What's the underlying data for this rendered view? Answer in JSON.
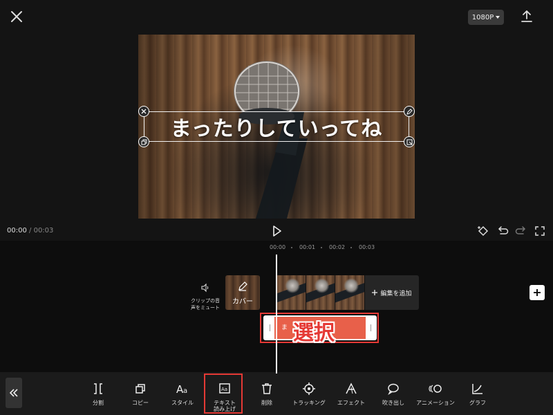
{
  "header": {
    "resolution": "1080P",
    "close_icon": "close-icon",
    "export_icon": "upload-icon"
  },
  "preview": {
    "caption": "まったりしていってね"
  },
  "playback": {
    "current_time": "00:00",
    "separator": "/",
    "duration": "00:03"
  },
  "timeline": {
    "ruler": [
      "00:00",
      "00:01",
      "00:02",
      "00:03"
    ],
    "mute_label": "クリップの音\n声をミュート",
    "cover_label": "カバー",
    "add_edit_label": "編集を追加",
    "text_clip_label": "ま　　　　てね",
    "annotation": "選択"
  },
  "toolbar": {
    "items": [
      {
        "label": "分割",
        "icon": "split-icon"
      },
      {
        "label": "コピー",
        "icon": "copy-icon"
      },
      {
        "label": "スタイル",
        "icon": "style-icon"
      },
      {
        "label": "テキスト\n読み上げ",
        "icon": "text-to-speech-icon"
      },
      {
        "label": "削除",
        "icon": "delete-icon"
      },
      {
        "label": "トラッキング",
        "icon": "tracking-icon"
      },
      {
        "label": "エフェクト",
        "icon": "effect-icon"
      },
      {
        "label": "吹き出し",
        "icon": "speech-bubble-icon"
      },
      {
        "label": "アニメーション",
        "icon": "animation-icon"
      },
      {
        "label": "グラフ",
        "icon": "graph-icon"
      }
    ]
  },
  "colors": {
    "highlight": "#e53935",
    "text_clip": "#e8604a",
    "background": "#141414"
  }
}
